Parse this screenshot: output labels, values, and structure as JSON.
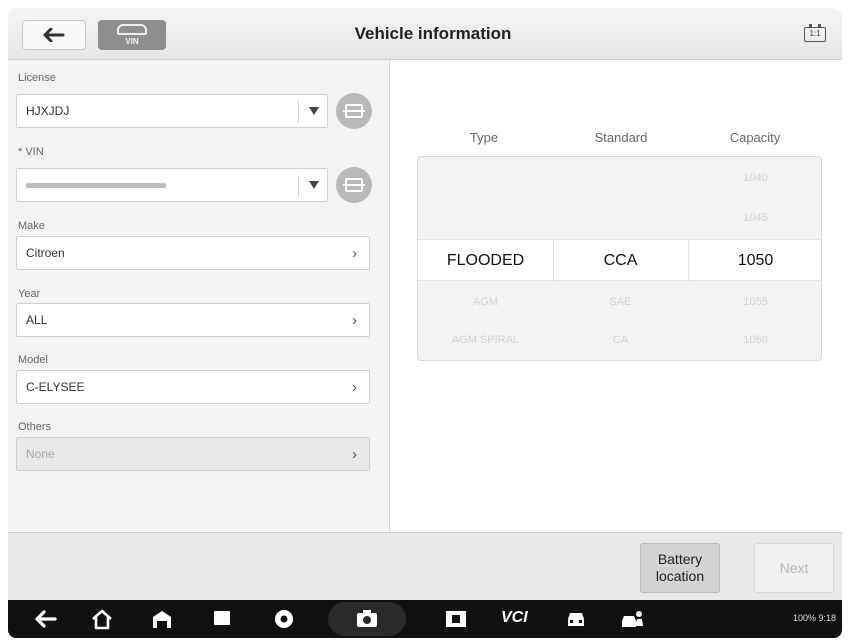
{
  "header": {
    "title": "Vehicle information",
    "vin_badge_label": "VIN",
    "battery_icon_label": "1:1"
  },
  "form": {
    "license": {
      "label": "License",
      "value": "HJXJDJ"
    },
    "vin": {
      "label": "* VIN"
    },
    "make": {
      "label": "Make",
      "value": "Citroen"
    },
    "year": {
      "label": "Year",
      "value": "ALL"
    },
    "model": {
      "label": "Model",
      "value": "C-ELYSEE"
    },
    "others": {
      "label": "Others",
      "value": "None"
    }
  },
  "picker": {
    "columns": [
      "Type",
      "Standard",
      "Capacity"
    ],
    "rows": [
      {
        "type": "",
        "standard": "",
        "capacity": "1040"
      },
      {
        "type": "",
        "standard": "",
        "capacity": "1045"
      },
      {
        "type": "FLOODED",
        "standard": "CCA",
        "capacity": "1050"
      },
      {
        "type": "AGM",
        "standard": "SAE",
        "capacity": "1055"
      },
      {
        "type": "AGM SPIRAL",
        "standard": "CA",
        "capacity": "1060"
      }
    ],
    "selected_index": 2
  },
  "footer": {
    "battery_location_label": "Battery location",
    "next_label": "Next"
  },
  "navbar": {
    "vci_label": "VCI",
    "status_text": "100% 9:18"
  }
}
